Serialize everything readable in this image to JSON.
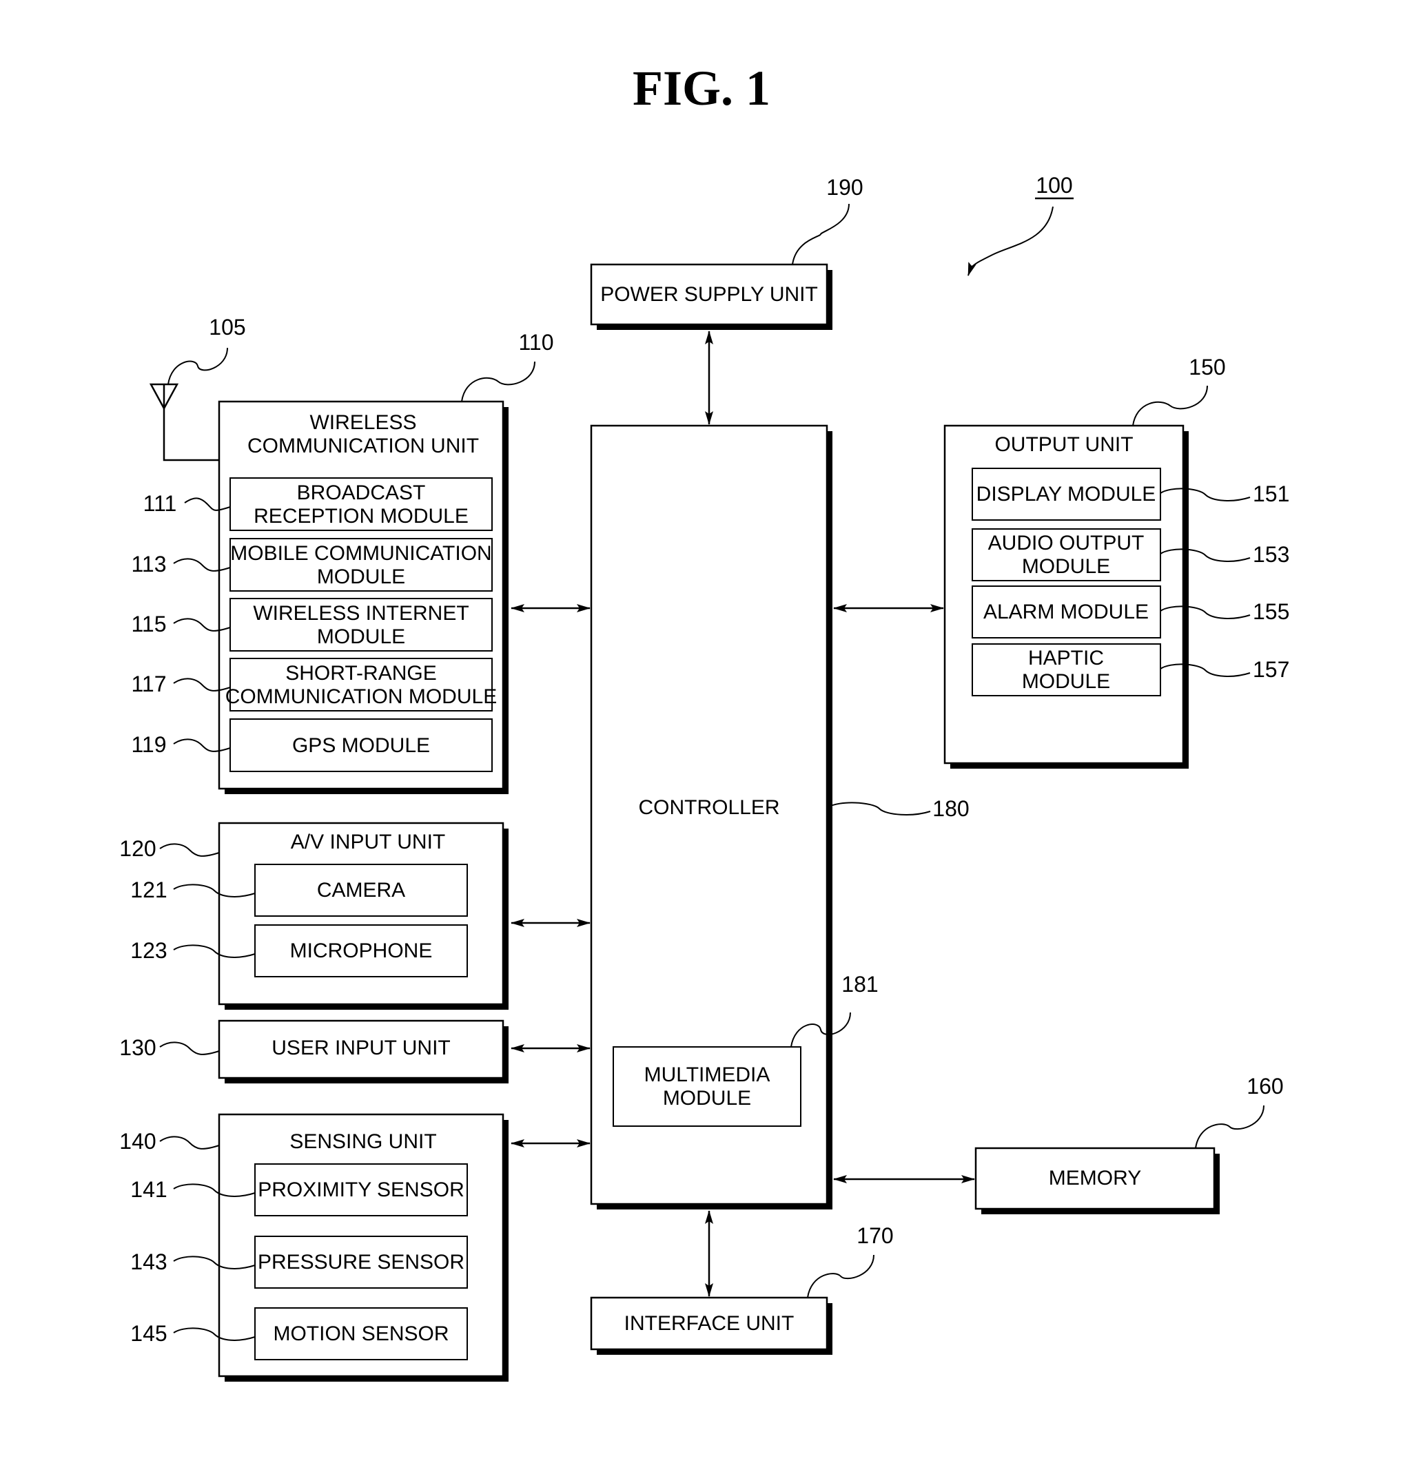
{
  "figure": {
    "title": "FIG. 1",
    "device_ref": "100",
    "colors": {
      "ink": "#000000",
      "paper": "#ffffff"
    }
  },
  "blocks": {
    "power_supply": {
      "ref": "190",
      "lines": [
        "POWER SUPPLY UNIT"
      ]
    },
    "wireless": {
      "ref": "110",
      "lines": [
        "WIRELESS",
        "COMMUNICATION UNIT"
      ],
      "antenna_ref": "105",
      "modules": [
        {
          "ref": "111",
          "lines": [
            "BROADCAST",
            "RECEPTION MODULE"
          ]
        },
        {
          "ref": "113",
          "lines": [
            "MOBILE COMMUNICATION",
            "MODULE"
          ]
        },
        {
          "ref": "115",
          "lines": [
            "WIRELESS INTERNET",
            "MODULE"
          ]
        },
        {
          "ref": "117",
          "lines": [
            "SHORT-RANGE",
            "COMMUNICATION MODULE"
          ]
        },
        {
          "ref": "119",
          "lines": [
            "GPS MODULE"
          ]
        }
      ]
    },
    "av_input": {
      "ref": "120",
      "lines": [
        "A/V INPUT UNIT"
      ],
      "modules": [
        {
          "ref": "121",
          "lines": [
            "CAMERA"
          ]
        },
        {
          "ref": "123",
          "lines": [
            "MICROPHONE"
          ]
        }
      ]
    },
    "user_input": {
      "ref": "130",
      "lines": [
        "USER INPUT UNIT"
      ]
    },
    "sensing": {
      "ref": "140",
      "lines": [
        "SENSING UNIT"
      ],
      "modules": [
        {
          "ref": "141",
          "lines": [
            "PROXIMITY SENSOR"
          ]
        },
        {
          "ref": "143",
          "lines": [
            "PRESSURE SENSOR"
          ]
        },
        {
          "ref": "145",
          "lines": [
            "MOTION SENSOR"
          ]
        }
      ]
    },
    "output": {
      "ref": "150",
      "lines": [
        "OUTPUT UNIT"
      ],
      "modules": [
        {
          "ref": "151",
          "lines": [
            "DISPLAY MODULE"
          ]
        },
        {
          "ref": "153",
          "lines": [
            "AUDIO OUTPUT",
            "MODULE"
          ]
        },
        {
          "ref": "155",
          "lines": [
            "ALARM MODULE"
          ]
        },
        {
          "ref": "157",
          "lines": [
            "HAPTIC",
            "MODULE"
          ]
        }
      ]
    },
    "memory": {
      "ref": "160",
      "lines": [
        "MEMORY"
      ]
    },
    "interface": {
      "ref": "170",
      "lines": [
        "INTERFACE UNIT"
      ]
    },
    "controller": {
      "ref": "180",
      "lines": [
        "CONTROLLER"
      ],
      "multimedia": {
        "ref": "181",
        "lines": [
          "MULTIMEDIA",
          "MODULE"
        ]
      }
    }
  },
  "connections": [
    {
      "from": "controller",
      "to": "power_supply",
      "type": "bidirectional"
    },
    {
      "from": "controller",
      "to": "wireless",
      "type": "bidirectional"
    },
    {
      "from": "controller",
      "to": "av_input",
      "type": "bidirectional"
    },
    {
      "from": "controller",
      "to": "user_input",
      "type": "bidirectional"
    },
    {
      "from": "controller",
      "to": "sensing",
      "type": "bidirectional"
    },
    {
      "from": "controller",
      "to": "output",
      "type": "bidirectional"
    },
    {
      "from": "controller",
      "to": "memory",
      "type": "bidirectional"
    },
    {
      "from": "controller",
      "to": "interface",
      "type": "bidirectional"
    }
  ]
}
